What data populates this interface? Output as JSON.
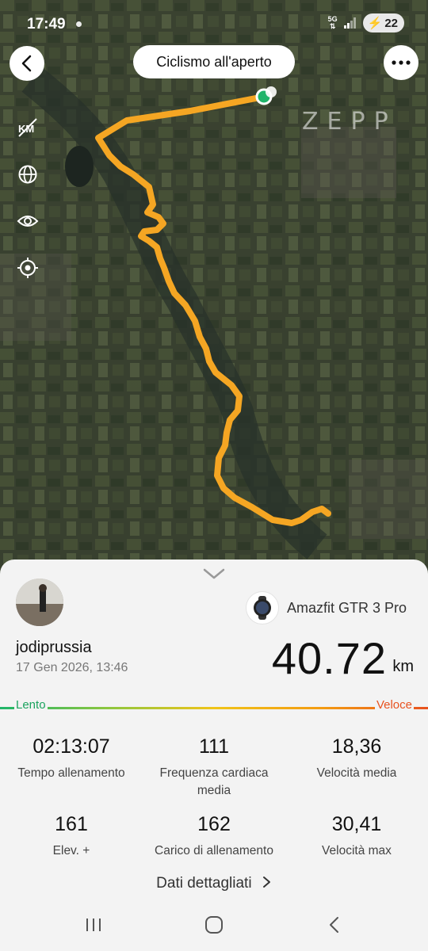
{
  "status_bar": {
    "time": "17:49",
    "network": "5G",
    "battery": "22"
  },
  "header": {
    "title": "Ciclismo all'aperto"
  },
  "map": {
    "brand_watermark": "ZEPP",
    "route_color": "#f5a623",
    "start_marker_color": "#1fb56a"
  },
  "side_tools": [
    {
      "icon": "km-marker-icon"
    },
    {
      "icon": "globe-icon"
    },
    {
      "icon": "eye-icon"
    },
    {
      "icon": "locate-icon"
    }
  ],
  "profile": {
    "username": "jodiprussia",
    "date": "17 Gen 2026, 13:46"
  },
  "device": {
    "name": "Amazfit GTR 3 Pro"
  },
  "summary": {
    "distance": "40.72",
    "unit": "km"
  },
  "speed_legend": {
    "slow": "Lento",
    "fast": "Veloce"
  },
  "stats": [
    {
      "value": "02:13:07",
      "label": "Tempo allenamento"
    },
    {
      "value": "111",
      "label": "Frequenza cardiaca media"
    },
    {
      "value": "18,36",
      "label": "Velocità media"
    },
    {
      "value": "161",
      "label": "Elev. +"
    },
    {
      "value": "162",
      "label": "Carico di allenamento"
    },
    {
      "value": "30,41",
      "label": "Velocità max"
    }
  ],
  "details_link": "Dati dettagliati"
}
